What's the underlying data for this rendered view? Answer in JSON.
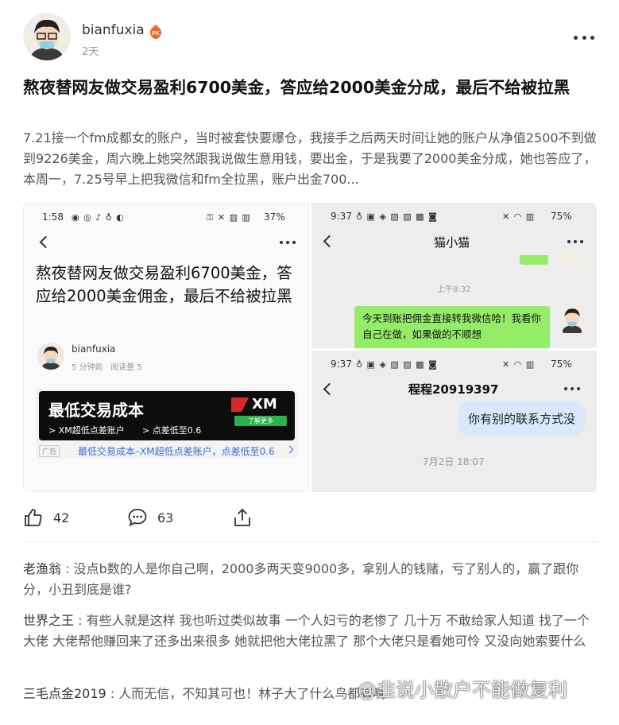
{
  "post": {
    "username": "bianfuxia",
    "level_badge": "PK",
    "time": "2天",
    "title": "熬夜替网友做交易盈利6700美金，答应给2000美金分成，最后不给被拉黑",
    "body": "7.21接一个fm成都女的账户，当时被套快要爆仓，我接手之后两天时间让她的账户从净值2500不到做到9226美金，周六晚上她突然跟我说做生意用钱，要出金，于是我要了2000美金分成，她也答应了，本周一，7.25号早上把我微信和fm全拉黑，账户出金700..."
  },
  "screenshot1": {
    "status_time": "1:58",
    "status_right": "37%",
    "title": "熬夜替网友做交易盈利6700美金，答应给2000美金佣金，最后不给被拉黑",
    "author": "bianfuxia",
    "meta": "5 分钟前 · 阅读量 5",
    "ad": {
      "headline": "最低交易成本",
      "sub1": "> XM超低点差账户",
      "sub2": "> 点差低至0.6",
      "logo": "XM",
      "button": "了解更多",
      "tag": "广告",
      "link": "最低交易成本–XM超低点差账户，点差低至0.6"
    }
  },
  "screenshot2": {
    "status_time": "9:37",
    "status_right": "75%",
    "chat_name": "猫小猫",
    "time_divider": "上午8:32",
    "message": "今天到账把佣金直接转我微信哈！我看你自己在做，如果做的不顺想"
  },
  "screenshot3": {
    "status_time": "9:37",
    "status_right": "75%",
    "chat_name": "程程20919397",
    "message": "你有别的联系方式没",
    "time_divider": "7月2日 18:07"
  },
  "actions": {
    "likes": "42",
    "comments": "63"
  },
  "comments": [
    {
      "name": "老渔翁",
      "text": "没点b数的人是你自己啊，2000多两天变9000多，拿别人的钱赌，亏了别人的，赢了跟你分，小丑到底是谁?"
    },
    {
      "name": "世界之王",
      "text": "有些人就是这样 我也听过类似故事 一个人妇亏的老惨了 几十万 不敢给家人知道 找了一个大佬 大佬帮他赚回来了还多出来很多 她就把他大佬拉黑了 那个大佬只是看她可怜 又没向她索要什么"
    },
    {
      "name": "三毛点金2019",
      "text": "人而无信，不知其可也！林子大了什么鸟都有啊"
    }
  ],
  "watermark": "@韭说小散户不能做复利",
  "colors": {
    "ad_link": "#3b6fd6",
    "bubble_green": "#95ec69",
    "bubble_blue": "#d9e8fb",
    "xm_red": "#d62a2a",
    "xm_green": "#2bb24c"
  }
}
